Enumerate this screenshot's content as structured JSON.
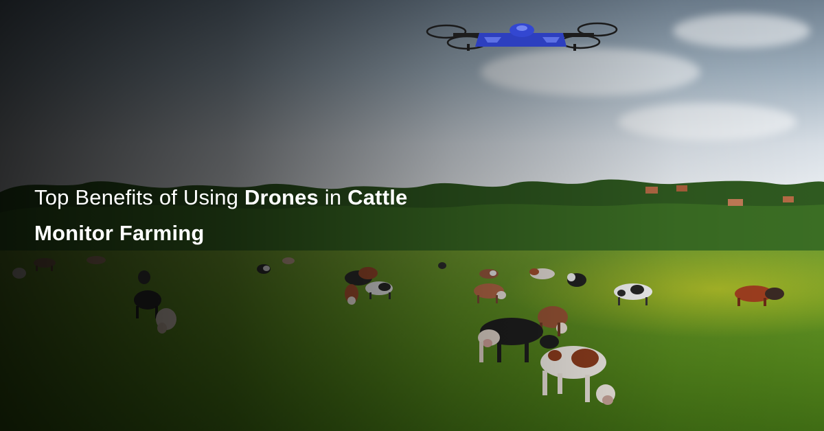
{
  "headline": {
    "line1": {
      "part1": "Top Benefits of Using ",
      "part2": "Drones",
      "part3": " in ",
      "part4": "Cattle"
    },
    "line2": "Monitor Farming"
  },
  "colors": {
    "headline_text": "#ffffff",
    "drone_body": "#2d3fbf",
    "field_green": "#5f8f23",
    "sky_light": "#eef1f4"
  },
  "scene": {
    "icons": [
      "drone-icon",
      "cow-icon"
    ]
  }
}
